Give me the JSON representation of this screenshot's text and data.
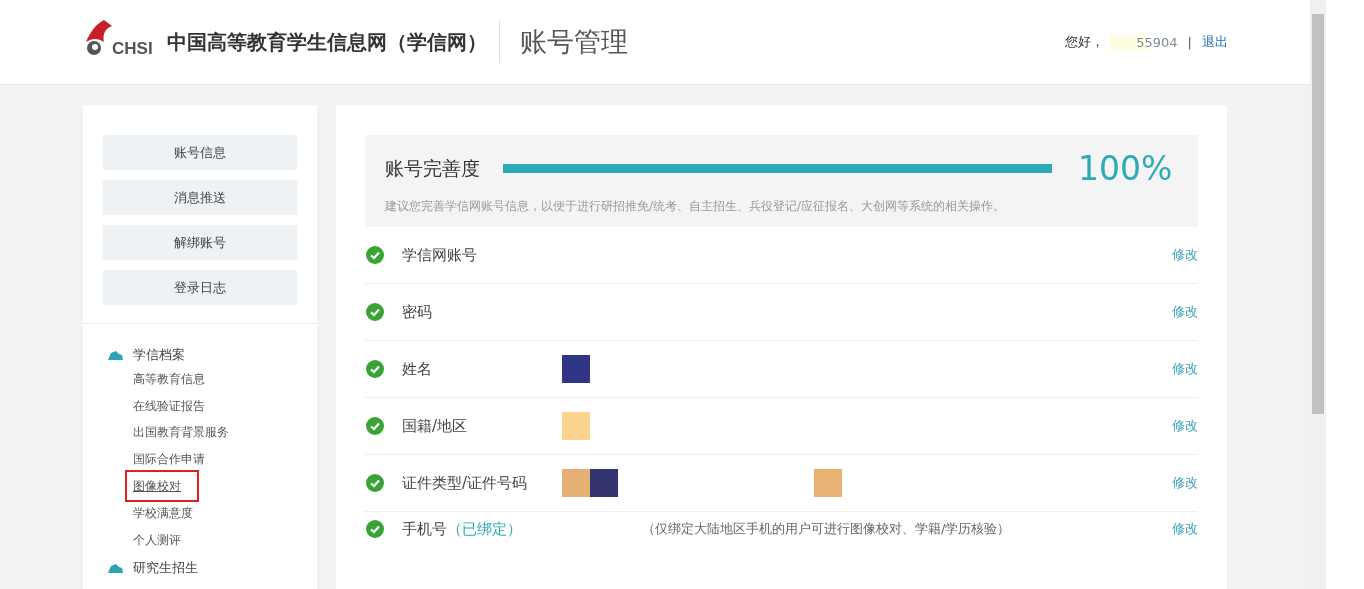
{
  "header": {
    "logo_text": "CHSI",
    "site_name": "中国高等教育学生信息网（学信网）",
    "page_title": "账号管理",
    "greeting": "您好，",
    "username": "55904",
    "separator": "|",
    "logout": "退出"
  },
  "sidebar": {
    "buttons": [
      {
        "label": "账号信息"
      },
      {
        "label": "消息推送"
      },
      {
        "label": "解绑账号"
      },
      {
        "label": "登录日志"
      }
    ],
    "sections": [
      {
        "title": "学信档案",
        "children": [
          {
            "label": "高等教育信息",
            "highlighted": false
          },
          {
            "label": "在线验证报告",
            "highlighted": false
          },
          {
            "label": "出国教育背景服务",
            "highlighted": false
          },
          {
            "label": "国际合作申请",
            "highlighted": false
          },
          {
            "label": "图像校对",
            "highlighted": true
          },
          {
            "label": "学校满意度",
            "highlighted": false
          },
          {
            "label": "个人测评",
            "highlighted": false
          }
        ]
      },
      {
        "title": "研究生招生"
      }
    ]
  },
  "completeness": {
    "label": "账号完善度",
    "level": 1.0,
    "percent": "100%",
    "hint": "建议您完善学信网账号信息，以便于进行研招推免/统考、自主招生、兵役登记/应征报名、大创网等系统的相关操作。"
  },
  "fields": [
    {
      "label": "学信网账号",
      "done": true,
      "action": "修改"
    },
    {
      "label": "密码",
      "done": true,
      "action": "修改"
    },
    {
      "label": "姓名",
      "done": true,
      "mask_groups": [
        {
          "blocks": [
            {
              "color": "#303585"
            }
          ]
        }
      ],
      "action": "修改"
    },
    {
      "label": "国籍/地区",
      "done": true,
      "mask_groups": [
        {
          "blocks": [
            {
              "color": "#fcd38f"
            }
          ]
        }
      ],
      "action": "修改"
    },
    {
      "label": "证件类型/证件号码",
      "done": true,
      "mask_groups": [
        {
          "blocks": [
            {
              "color": "#e6b074"
            },
            {
              "color": "#32336f"
            }
          ]
        },
        {
          "blocks": [
            {
              "color": "#e8b372"
            }
          ]
        }
      ],
      "action": "修改"
    },
    {
      "label": "手机号",
      "status": "（已绑定）",
      "note": "（仅绑定大陆地区手机的用户可进行图像校对、学籍/学历核验）",
      "done": true,
      "action": "修改"
    }
  ]
}
